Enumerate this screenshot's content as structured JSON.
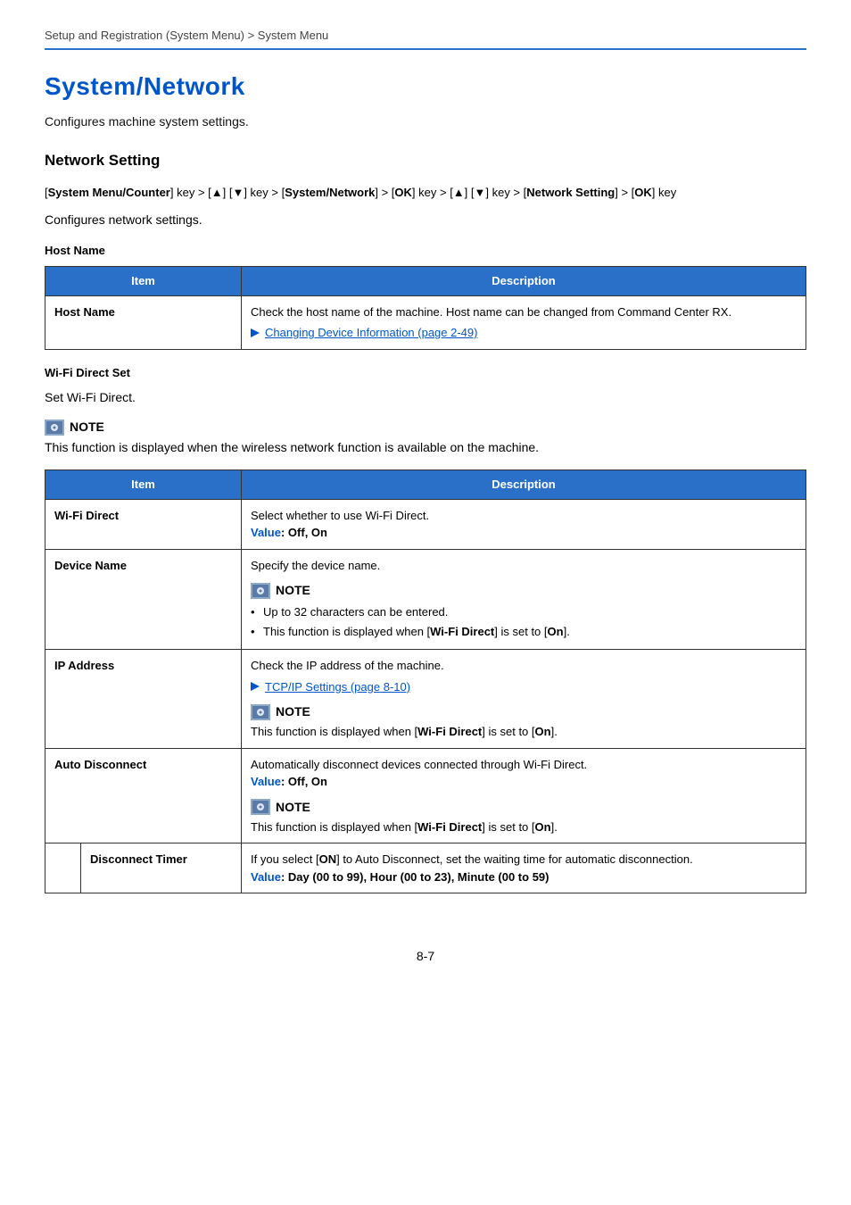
{
  "header": {
    "breadcrumb": "Setup and Registration (System Menu) > System Menu"
  },
  "title": "System/Network",
  "intro": "Configures machine system settings.",
  "section1": {
    "heading": "Network Setting",
    "path_prefix": "[",
    "path": {
      "p1": "System Menu/Counter",
      "p2": "] key > [▲] [▼] key > [",
      "p3": "System/Network",
      "p4": "] > [",
      "p5": "OK",
      "p6": "] key > [▲] [▼] key > [",
      "p7": "Network Setting",
      "p8": "] > [",
      "p9": "OK",
      "p10": "] key"
    },
    "desc": "Configures network settings."
  },
  "hostname": {
    "heading": "Host Name",
    "col_item": "Item",
    "col_desc": "Description",
    "row_item": "Host Name",
    "row_desc": "Check the host name of the machine. Host name can be changed from Command Center RX.",
    "link": "Changing Device Information (page 2-49)"
  },
  "wifi": {
    "heading": "Wi-Fi Direct Set",
    "desc": "Set Wi-Fi Direct.",
    "note_label": "NOTE",
    "note_body": "This function is displayed when the wireless network function is available on the machine.",
    "col_item": "Item",
    "col_desc": "Description",
    "rows": {
      "r1": {
        "item": "Wi-Fi Direct",
        "desc": "Select whether to use Wi-Fi Direct.",
        "value_label": "Value",
        "value_sep": ": ",
        "value_text": "Off, On"
      },
      "r2": {
        "item": "Device Name",
        "desc": "Specify the device name.",
        "note_label": "NOTE",
        "b1": "Up to 32 characters can be entered.",
        "b2_pre": "This function is displayed when [",
        "b2_bold1": "Wi-Fi Direct",
        "b2_mid": "] is set to [",
        "b2_bold2": "On",
        "b2_post": "]."
      },
      "r3": {
        "item": "IP Address",
        "desc": "Check the IP address of the machine.",
        "link": "TCP/IP Settings (page 8-10)",
        "note_label": "NOTE",
        "nb_pre": "This function is displayed when [",
        "nb_bold1": "Wi-Fi Direct",
        "nb_mid": "] is set to [",
        "nb_bold2": "On",
        "nb_post": "]."
      },
      "r4": {
        "item": "Auto Disconnect",
        "desc": "Automatically disconnect devices connected through Wi-Fi Direct.",
        "value_label": "Value",
        "value_sep": ": ",
        "value_text": "Off, On",
        "note_label": "NOTE",
        "nb_pre": "This function is displayed when [",
        "nb_bold1": "Wi-Fi Direct",
        "nb_mid": "] is set to [",
        "nb_bold2": "On",
        "nb_post": "]."
      },
      "r5": {
        "item": "Disconnect Timer",
        "d_pre": "If you select [",
        "d_bold": "ON",
        "d_post": "] to Auto Disconnect, set the waiting time for automatic disconnection.",
        "value_label": "Value",
        "value_sep": ": ",
        "value_text": "Day (00 to 99), Hour (00 to 23), Minute (00 to 59)"
      }
    }
  },
  "pagenum": "8-7"
}
